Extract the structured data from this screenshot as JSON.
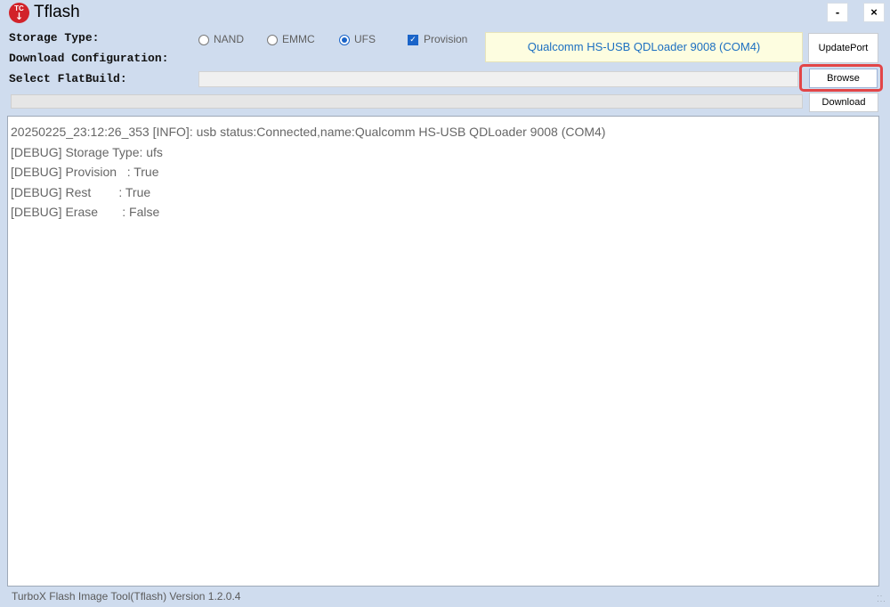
{
  "window": {
    "logo_text": "TC",
    "logo_arrow": "↓",
    "title": "Tflash",
    "minimize_label": "-",
    "close_label": "×"
  },
  "labels": {
    "storage_type": "Storage Type:",
    "download_configuration": "Download Configuration:",
    "select_flatbuild": "Select FlatBuild:"
  },
  "storage_options": [
    {
      "label": "NAND",
      "selected": false
    },
    {
      "label": "EMMC",
      "selected": false
    },
    {
      "label": "UFS",
      "selected": true
    }
  ],
  "provision": {
    "label": "Provision",
    "checked": true,
    "check_glyph": "✓"
  },
  "port": {
    "display": "Qualcomm HS-USB QDLoader 9008 (COM4)",
    "update_label": "UpdatePort"
  },
  "buttons": {
    "browse": "Browse",
    "download": "Download"
  },
  "flatbuild_path": "",
  "progress": 0,
  "log": [
    "20250225_23:12:26_353 [INFO]: usb status:Connected,name:Qualcomm HS-USB QDLoader 9008 (COM4)",
    "[DEBUG] Storage Type: ufs",
    "[DEBUG] Provision   : True",
    "[DEBUG] Rest        : True",
    "[DEBUG] Erase       : False"
  ],
  "status": "TurboX Flash Image Tool(Tflash) Version 1.2.0.4",
  "colors": {
    "background": "#cfdcee",
    "accent": "#1a64c8",
    "highlight": "#e24547",
    "logo": "#d2232a"
  }
}
